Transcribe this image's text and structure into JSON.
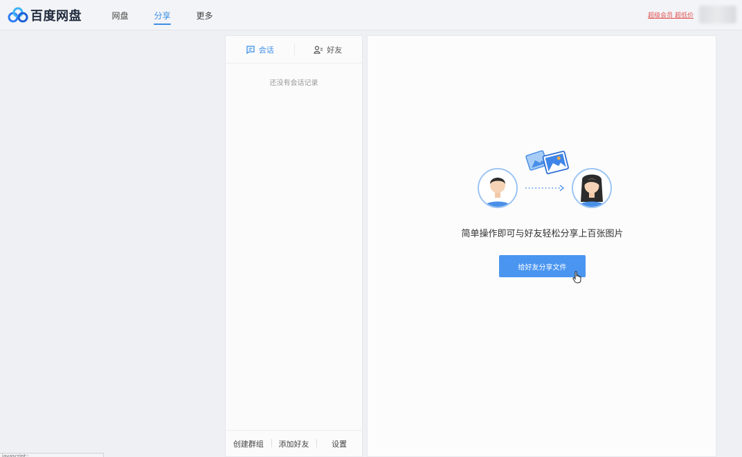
{
  "app": {
    "logo_text": "百度网盘"
  },
  "nav": {
    "items": [
      {
        "label": "网盘"
      },
      {
        "label": "分享"
      },
      {
        "label": "更多"
      }
    ],
    "active": 1
  },
  "topbar": {
    "vip_link": "超级会员 超低价"
  },
  "chat": {
    "tabs": [
      {
        "label": "会话",
        "icon": "chat-bubble-icon"
      },
      {
        "label": "好友",
        "icon": "friends-icon"
      }
    ],
    "empty_text": "还没有会话记录",
    "footer": {
      "create_group": "创建群组",
      "add_friend": "添加好友",
      "settings": "设置"
    }
  },
  "main": {
    "message": "简单操作即可与好友轻松分享上百张图片",
    "share_button": "给好友分享文件"
  },
  "statusbar": {
    "text": "javascript:;"
  },
  "colors": {
    "accent": "#3a8ee6",
    "button": "#4a95f0",
    "vip": "#e05252"
  }
}
